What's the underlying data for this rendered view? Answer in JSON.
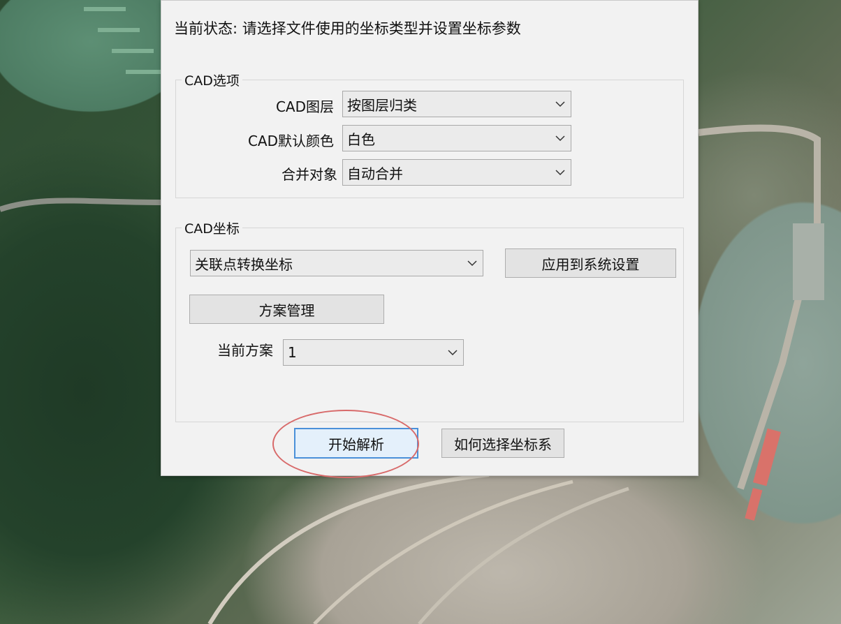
{
  "status_text": "当前状态: 请选择文件使用的坐标类型并设置坐标参数",
  "cad_options": {
    "legend": "CAD选项",
    "layer_label": "CAD图层",
    "layer_value": "按图层归类",
    "color_label": "CAD默认颜色",
    "color_value": "白色",
    "merge_label": "合并对象",
    "merge_value": "自动合并"
  },
  "cad_coords": {
    "legend": "CAD坐标",
    "conversion_value": "关联点转换坐标",
    "apply_button": "应用到系统设置",
    "scheme_button": "方案管理",
    "current_scheme_label": "当前方案",
    "current_scheme_value": "1"
  },
  "footer": {
    "start_button": "开始解析",
    "help_button": "如何选择坐标系"
  },
  "colors": {
    "highlight": "#d86a6a",
    "primary_border": "#4a90d9"
  },
  "icons": {
    "dropdown": "chevron-down-icon"
  }
}
